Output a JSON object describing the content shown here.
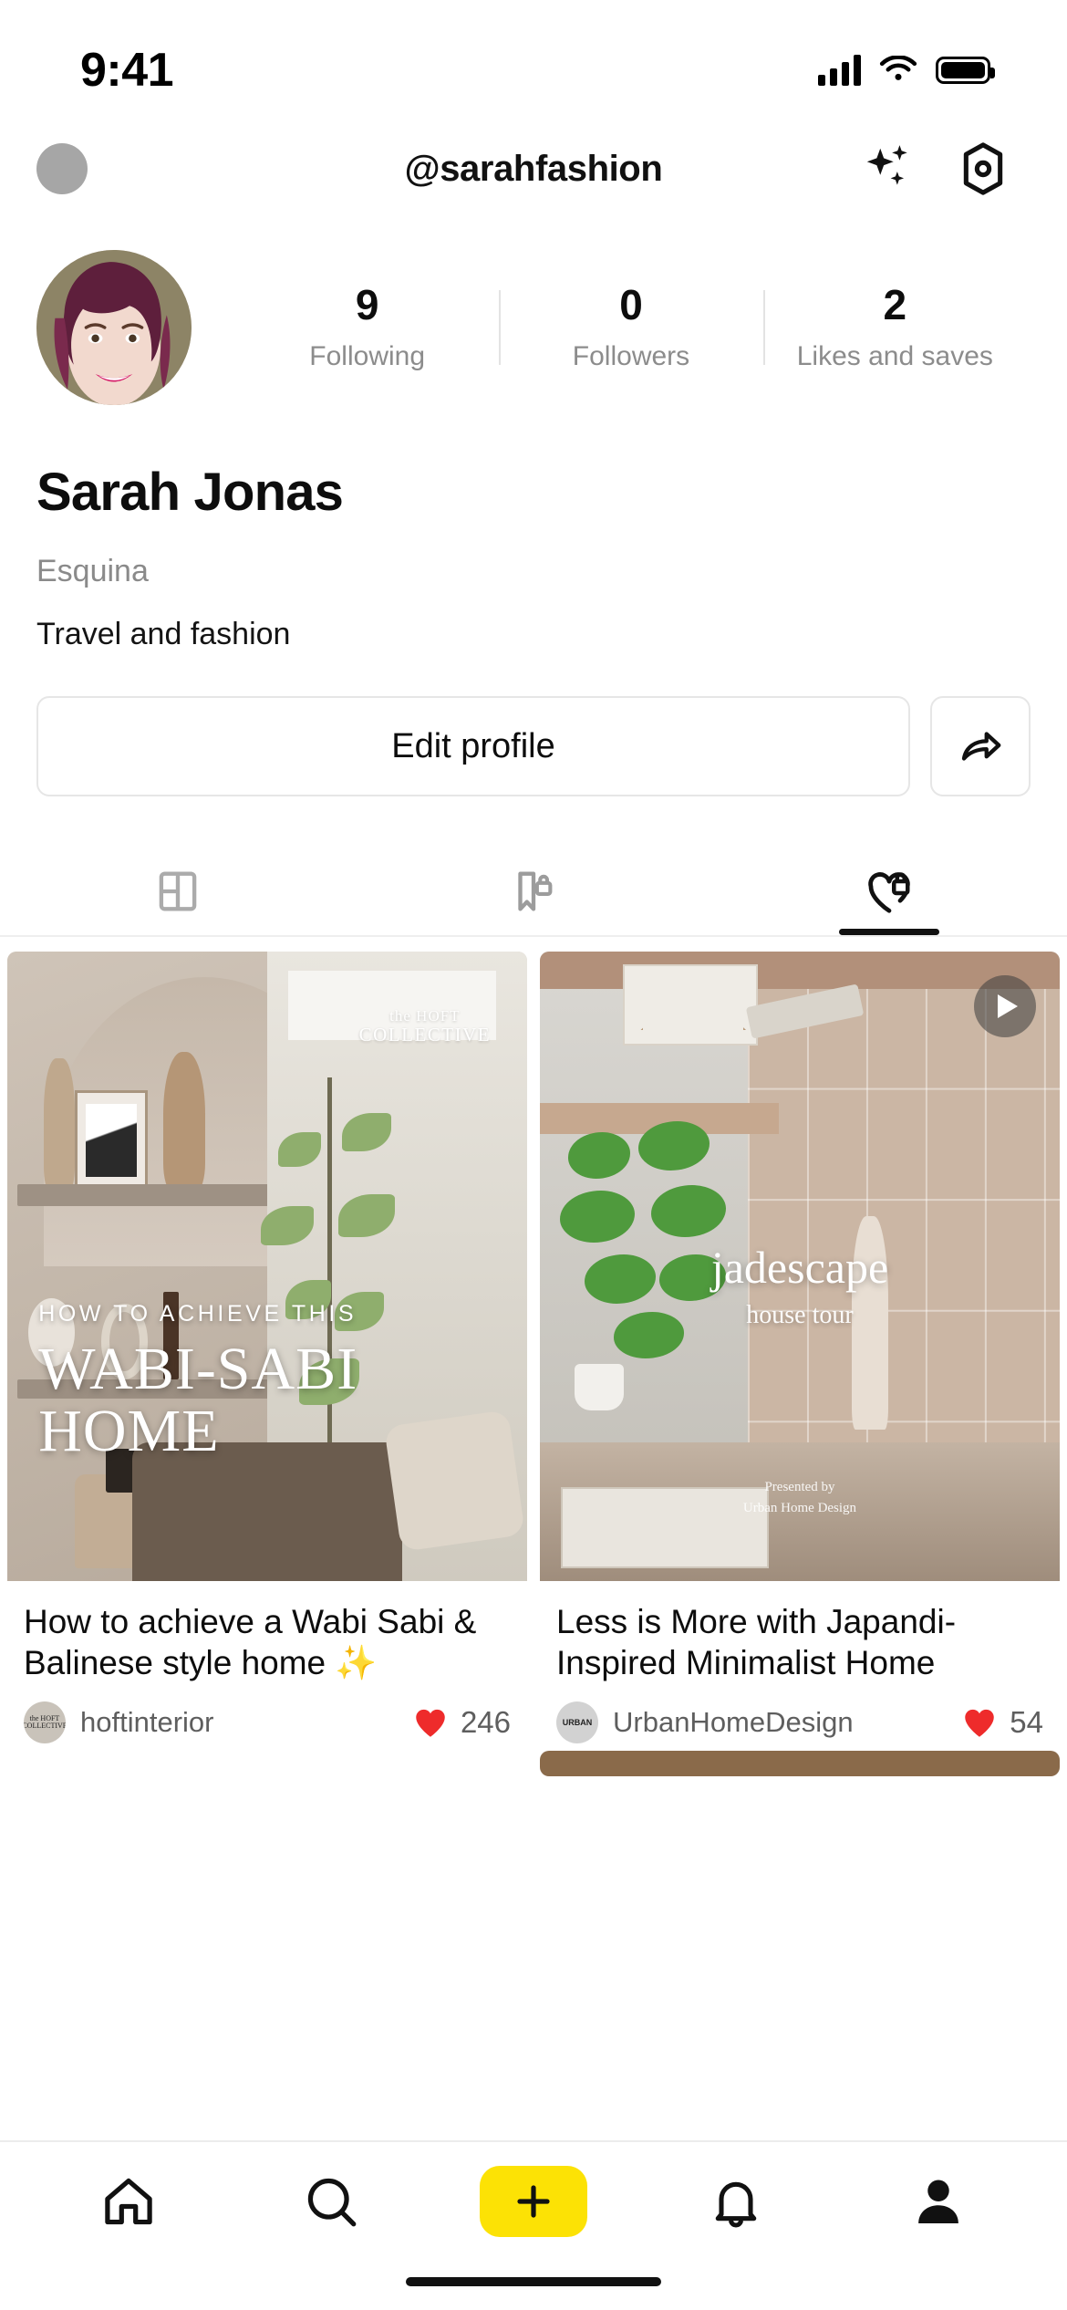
{
  "status_bar": {
    "time": "9:41",
    "cellular_icon": "cellular-signal-icon",
    "wifi_icon": "wifi-icon",
    "battery_icon": "battery-full-icon"
  },
  "nav": {
    "title": "@sarahfashion",
    "avatar_icon": "account-avatar-icon",
    "sparkles_icon": "sparkles-icon",
    "settings_icon": "hexagon-settings-icon"
  },
  "profile": {
    "avatar_icon": "profile-photo",
    "name": "Sarah Jonas",
    "location": "Esquina",
    "bio": "Travel and fashion",
    "stats": [
      {
        "value": "9",
        "label": "Following"
      },
      {
        "value": "0",
        "label": "Followers"
      },
      {
        "value": "2",
        "label": "Likes and saves"
      }
    ]
  },
  "actions": {
    "edit_label": "Edit profile",
    "share_icon": "share-arrow-icon"
  },
  "tabs": [
    {
      "icon": "grid-layout-icon",
      "active": false
    },
    {
      "icon": "bookmark-lock-icon",
      "active": false
    },
    {
      "icon": "heart-lock-icon",
      "active": true
    }
  ],
  "feed": {
    "cards": [
      {
        "overlay_kicker": "HOW TO ACHIEVE THIS",
        "overlay_title": "WABI-SABI HOME",
        "watermark_line1": "the HOFT",
        "watermark_line2": "COLLECTIVE",
        "title": "How to achieve a Wabi Sabi & Balinese style home ✨",
        "author": "hoftinterior",
        "author_badge": "the HOFT COLLECTIVE",
        "likes": "246",
        "like_icon": "heart-filled-icon",
        "has_video": false
      },
      {
        "overlay_title": "jadescape",
        "overlay_subtitle": "house tour",
        "presented_line1": "Presented by",
        "presented_line2": "Urban Home Design",
        "title": "Less is More with Japandi-Inspired Minimalist Home",
        "author": "UrbanHomeDesign",
        "author_badge": "URBAN",
        "likes": "54",
        "like_icon": "heart-filled-icon",
        "has_video": true,
        "play_icon": "play-icon"
      }
    ]
  },
  "bottom_nav": {
    "items": [
      {
        "icon": "home-icon",
        "active": true
      },
      {
        "icon": "search-icon",
        "active": false
      },
      {
        "icon": "plus-create-icon",
        "active": false
      },
      {
        "icon": "bell-notifications-icon",
        "active": false
      },
      {
        "icon": "person-profile-icon",
        "active": false
      }
    ],
    "create_button_color": "#FCE205",
    "home_indicator": "home-indicator"
  },
  "colors": {
    "accent_yellow": "#FCE205",
    "heart_red": "#EE2B2B",
    "text_primary": "#0d0d0d",
    "text_secondary": "#8a8a8a"
  }
}
